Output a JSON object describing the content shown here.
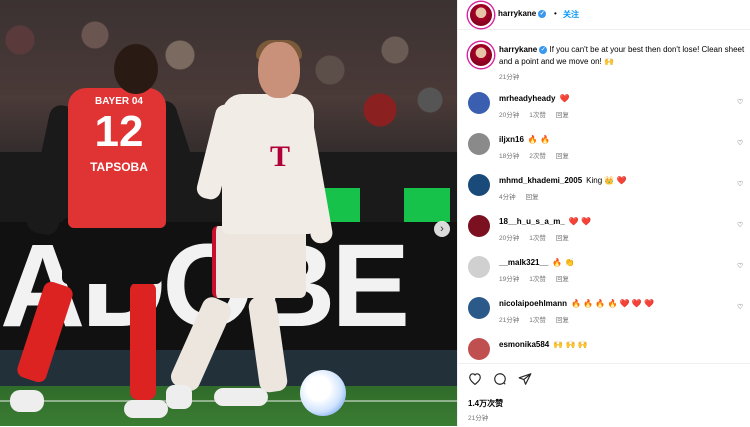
{
  "header": {
    "username": "harrykane",
    "separator": "•",
    "follow_label": "关注"
  },
  "photo": {
    "ad_text": "ADOBE",
    "player_12_sponsor": "BAYER 04",
    "player_12_number": "12",
    "player_12_name": "TAPSOBA",
    "next_label": "›"
  },
  "caption": {
    "username": "harrykane",
    "text": "If you can't be at your best then don't lose! Clean sheet and a point and we move on! 🙌",
    "time": "21分钟"
  },
  "comments": [
    {
      "user": "mrheadyheady",
      "text": "❤️",
      "time": "20分钟",
      "likes": "1次赞",
      "reply": "回复",
      "avatar_color": "#3a5fb0"
    },
    {
      "user": "iljxn16",
      "text": "🔥 🔥",
      "time": "18分钟",
      "likes": "2次赞",
      "reply": "回复",
      "avatar_color": "#8a8a8a"
    },
    {
      "user": "mhmd_khademi_2005",
      "text": "King 👑 ❤️",
      "time": "4分钟",
      "likes": "",
      "reply": "回复",
      "avatar_color": "#1a4a7a"
    },
    {
      "user": "18__h_u_s_a_m_",
      "text": "❤️ ❤️",
      "time": "20分钟",
      "likes": "1次赞",
      "reply": "回复",
      "avatar_color": "#7a1020"
    },
    {
      "user": "__malk321__",
      "text": "🔥 👏",
      "time": "19分钟",
      "likes": "1次赞",
      "reply": "回复",
      "avatar_color": "#d0d0d0"
    },
    {
      "user": "nicolaipoehlmann",
      "text": "🔥 🔥 🔥 🔥 ❤️ ❤️ ❤️",
      "time": "21分钟",
      "likes": "1次赞",
      "reply": "回复",
      "avatar_color": "#2b5a8a"
    },
    {
      "user": "esmonika584",
      "text": "🙌 🙌 🙌",
      "time": "",
      "likes": "",
      "reply": "",
      "avatar_color": "#c05050"
    }
  ],
  "actions": {
    "like_icon": "heart-outline-icon",
    "comment_icon": "comment-icon",
    "share_icon": "share-icon",
    "likes_count": "1.4万次赞",
    "post_time": "21分钟"
  },
  "colors": {
    "follow_blue": "#0095f6",
    "verified_blue": "#3897f0",
    "meta_gray": "#737373"
  }
}
